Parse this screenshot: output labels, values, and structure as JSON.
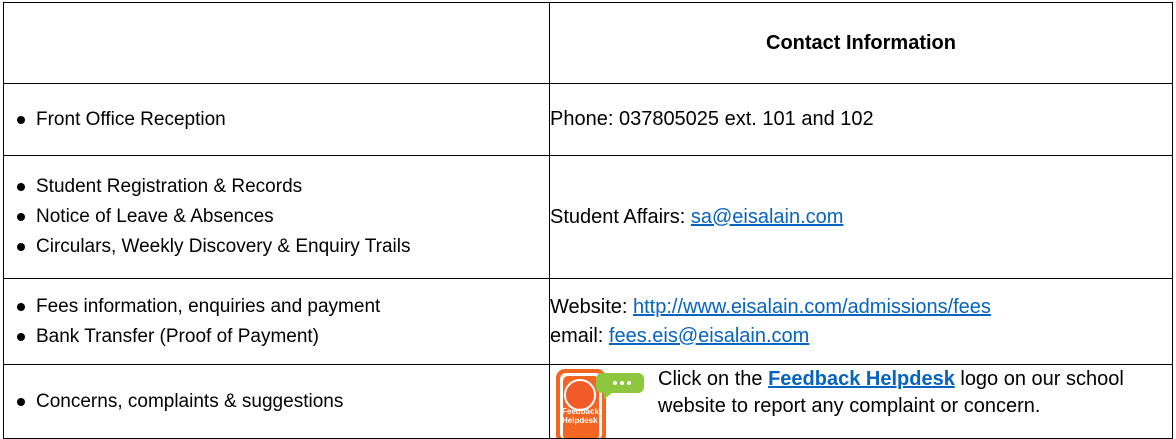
{
  "header": {
    "col1": "",
    "col2": "Contact Information"
  },
  "rows": [
    {
      "services": [
        "Front Office Reception"
      ],
      "contact": {
        "text": "Phone: 037805025 ext. 101 and 102"
      }
    },
    {
      "services": [
        "Student Registration & Records",
        "Notice of Leave & Absences",
        "Circulars, Weekly Discovery & Enquiry Trails"
      ],
      "contact": {
        "prefix": "Student Affairs: ",
        "email": "sa@eisalain.com"
      }
    },
    {
      "services": [
        "Fees information, enquiries and payment",
        "Bank Transfer (Proof of Payment)"
      ],
      "contact": {
        "website_prefix": "Website: ",
        "website": "http://www.eisalain.com/admissions/fees",
        "email_prefix": "email: ",
        "email": "fees.eis@eisalain.com"
      }
    },
    {
      "services": [
        "Concerns, complaints & suggestions"
      ],
      "contact": {
        "before": "Click on the ",
        "link": "Feedback Helpdesk",
        "after": " logo on our school website to report any complaint or concern.",
        "logo_text": "Feedback Helpdesk"
      }
    }
  ],
  "colors": {
    "link": "#0563c1",
    "logo_orange": "#f26522",
    "logo_green": "#8dc63f"
  }
}
